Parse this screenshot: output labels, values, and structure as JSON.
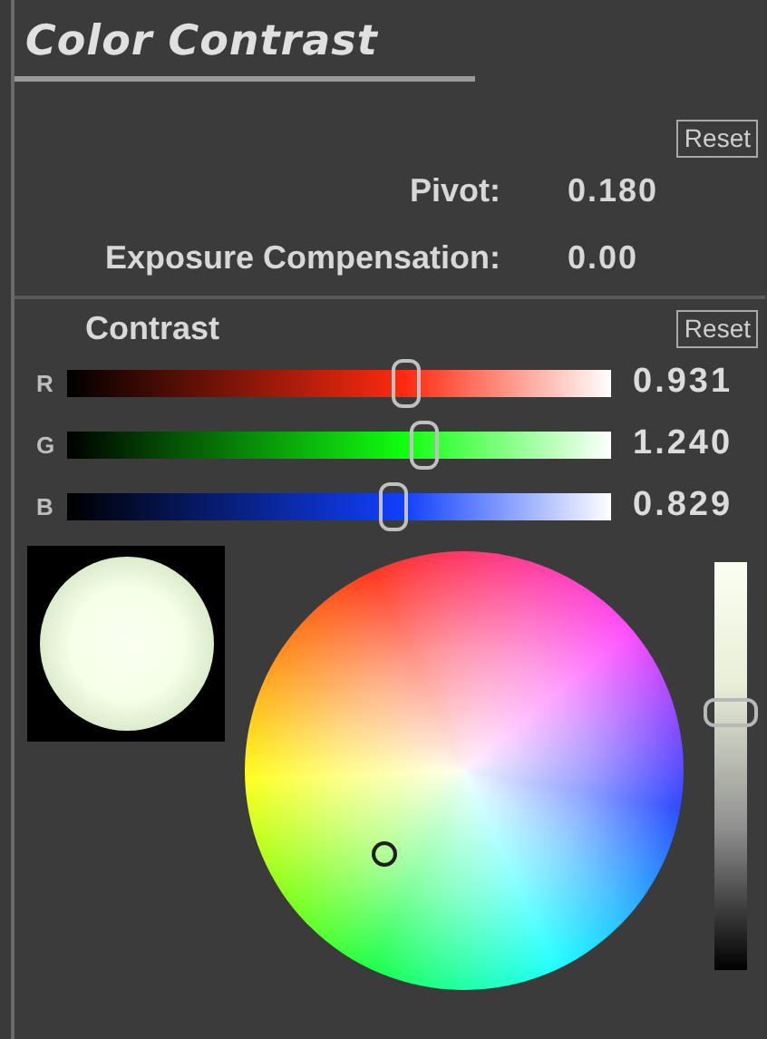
{
  "panel": {
    "title": "Color Contrast"
  },
  "pivot_section": {
    "reset_button": "Reset",
    "fields": [
      {
        "label": "Pivot:",
        "value": "0.180"
      },
      {
        "label": "Exposure Compensation:",
        "value": "0.00"
      }
    ]
  },
  "contrast": {
    "label": "Contrast",
    "reset_button": "Reset",
    "channels": [
      {
        "name": "R",
        "color": "#ff2a10",
        "level": 0.62,
        "value": "0.931"
      },
      {
        "name": "G",
        "color": "#10ff10",
        "level": 0.653,
        "value": "1.240"
      },
      {
        "name": "B",
        "color": "#1040ff",
        "level": 0.597,
        "value": "0.829"
      }
    ],
    "luminance_slider": {
      "level": 0.63
    }
  }
}
